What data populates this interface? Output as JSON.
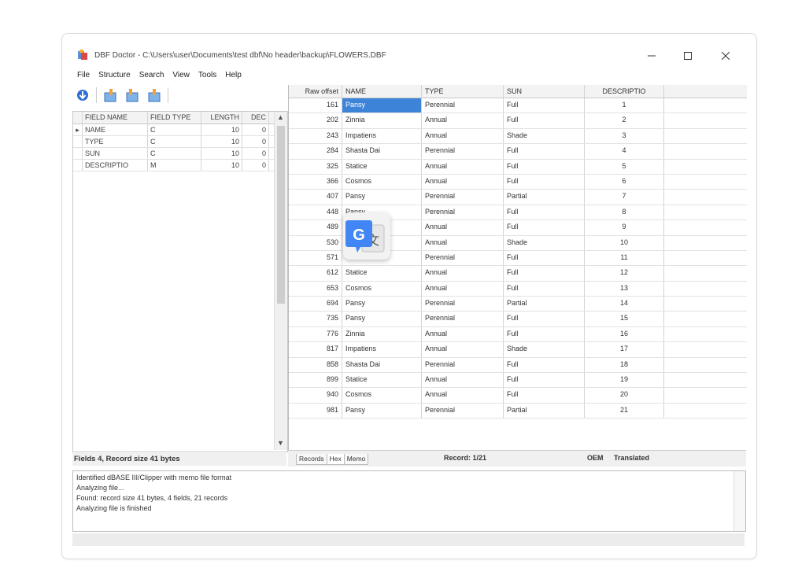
{
  "window": {
    "title": "DBF Doctor - C:\\Users\\user\\Documents\\test dbf\\No header\\backup\\FLOWERS.DBF"
  },
  "menu": [
    "File",
    "Structure",
    "Search",
    "View",
    "Tools",
    "Help"
  ],
  "toolbar": {
    "icons": [
      "arrow-down-icon",
      "table-add-icon",
      "table-insert-icon",
      "table-remove-icon"
    ]
  },
  "structure": {
    "headers": [
      "FIELD NAME",
      "FIELD TYPE",
      "LENGTH",
      "DEC"
    ],
    "rows": [
      {
        "indicator": "▸",
        "name": "NAME",
        "type": "C",
        "length": "10",
        "dec": "0"
      },
      {
        "indicator": "",
        "name": "TYPE",
        "type": "C",
        "length": "10",
        "dec": "0"
      },
      {
        "indicator": "",
        "name": "SUN",
        "type": "C",
        "length": "10",
        "dec": "0"
      },
      {
        "indicator": "",
        "name": "DESCRIPTIO",
        "type": "M",
        "length": "10",
        "dec": "0"
      }
    ],
    "status": "Fields 4, Record size 41 bytes"
  },
  "records": {
    "headers": [
      "Raw offset",
      "NAME",
      "TYPE",
      "SUN",
      "DESCRIPTIO"
    ],
    "rows": [
      [
        "161",
        "Pansy",
        "Perennial",
        "Full",
        "1"
      ],
      [
        "202",
        "Zinnia",
        "Annual",
        "Full",
        "2"
      ],
      [
        "243",
        "Impatiens",
        "Annual",
        "Shade",
        "3"
      ],
      [
        "284",
        "Shasta Dai",
        "Perennial",
        "Full",
        "4"
      ],
      [
        "325",
        "Statice",
        "Annual",
        "Full",
        "5"
      ],
      [
        "366",
        "Cosmos",
        "Annual",
        "Full",
        "6"
      ],
      [
        "407",
        "Pansy",
        "Perennial",
        "Partial",
        "7"
      ],
      [
        "448",
        "Pansy",
        "Perennial",
        "Full",
        "8"
      ],
      [
        "489",
        "",
        "Annual",
        "Full",
        "9"
      ],
      [
        "530",
        "",
        "Annual",
        "Shade",
        "10"
      ],
      [
        "571",
        "",
        "Perennial",
        "Full",
        "11"
      ],
      [
        "612",
        "Statice",
        "Annual",
        "Full",
        "12"
      ],
      [
        "653",
        "Cosmos",
        "Annual",
        "Full",
        "13"
      ],
      [
        "694",
        "Pansy",
        "Perennial",
        "Partial",
        "14"
      ],
      [
        "735",
        "Pansy",
        "Perennial",
        "Full",
        "15"
      ],
      [
        "776",
        "Zinnia",
        "Annual",
        "Full",
        "16"
      ],
      [
        "817",
        "Impatiens",
        "Annual",
        "Shade",
        "17"
      ],
      [
        "858",
        "Shasta Dai",
        "Perennial",
        "Full",
        "18"
      ],
      [
        "899",
        "Statice",
        "Annual",
        "Full",
        "19"
      ],
      [
        "940",
        "Cosmos",
        "Annual",
        "Full",
        "20"
      ],
      [
        "981",
        "Pansy",
        "Perennial",
        "Partial",
        "21"
      ]
    ],
    "tabs": [
      "Records",
      "Hex",
      "Memo"
    ],
    "record_status": "Record: 1/21",
    "codepage": "OEM",
    "mode": "Translated"
  },
  "log": [
    "Identified dBASE III/Clipper with memo file format",
    "Analyzing file...",
    "Found: record size 41 bytes, 4 fields, 21 records",
    "Analyzing file is finished"
  ],
  "colors": {
    "selection": "#3d84d8",
    "grid_header": "#f3f3f3"
  }
}
